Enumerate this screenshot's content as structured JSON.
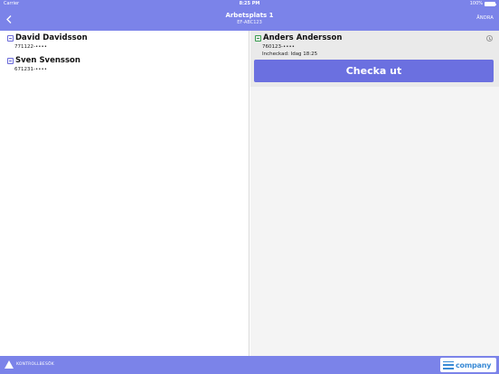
{
  "status_bar": {
    "carrier": "Carrier",
    "time": "8:25 PM",
    "battery": "100%"
  },
  "nav": {
    "title": "Arbetsplats 1",
    "subtitle": "EF-ABC123",
    "edit_label": "ÄNDRA",
    "back_icon": "chevron-left-icon"
  },
  "people_left": [
    {
      "name": "David Davidsson",
      "ssn": "771122-••••"
    },
    {
      "name": "Sven Svensson",
      "ssn": "671231-••••"
    }
  ],
  "checked_in": {
    "name": "Anders Andersson",
    "ssn": "760123-••••",
    "checkin": "Incheckad: Idag 18:25",
    "button": "Checka ut"
  },
  "bottom": {
    "control_label": "KONTROLLBESÖK",
    "logo_text": "company"
  },
  "colors": {
    "accent": "#7b83e9",
    "button": "#6b70e0"
  }
}
